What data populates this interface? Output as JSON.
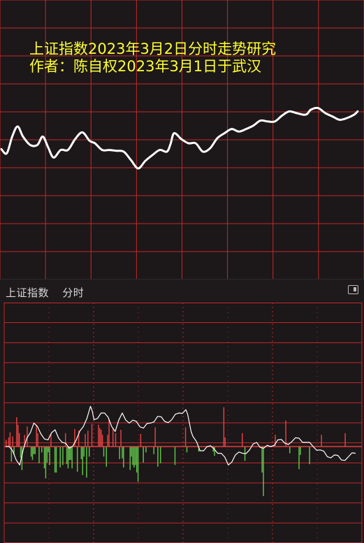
{
  "chart_data": [
    {
      "type": "line",
      "title_line1": "上证指数2023年3月2日分时走势研究",
      "title_line2": "作者：陈自权2023年3月1日于武汉",
      "title_color": "#ffff33",
      "grid": true,
      "grid_color": "#c02a2a",
      "line_color": "#ffffff",
      "xlim": [
        0,
        100
      ],
      "ylim": [
        0,
        100
      ],
      "series": [
        {
          "x": [
            0,
            1.5,
            3,
            4.5,
            6,
            8,
            10,
            11.5,
            13,
            14.5,
            16.5,
            18.5,
            20.5,
            22.5,
            24.5,
            26,
            28,
            30,
            32,
            34,
            36,
            38,
            40,
            42,
            44,
            46,
            47,
            48,
            50,
            52,
            54,
            56,
            58,
            60,
            62,
            64,
            66,
            68,
            70,
            72,
            74,
            76,
            78,
            80,
            82,
            84,
            85,
            86,
            88,
            90,
            92,
            94,
            96,
            98,
            99
          ],
          "y": [
            43,
            38,
            58,
            70,
            58,
            48,
            48,
            58,
            45,
            33,
            42,
            42,
            55,
            63,
            53,
            50,
            42,
            42,
            41,
            40,
            30,
            20,
            29,
            36,
            42,
            40,
            49,
            62,
            55,
            50,
            50,
            40,
            44,
            56,
            62,
            67,
            64,
            67,
            71,
            77,
            76,
            76,
            83,
            88,
            86,
            84,
            85,
            90,
            92,
            86,
            82,
            78,
            80,
            84,
            88
          ]
        }
      ]
    },
    {
      "type": "bar",
      "subtype": "intraday-volume-with-line",
      "grid": true,
      "grid_color": "#c02a2a",
      "up_color": "#e04040",
      "down_color": "#5fbf4a",
      "line_color": "#ffffff",
      "ylim": [
        -100,
        100
      ],
      "bars": [
        8,
        0,
        11,
        17,
        -18,
        12,
        -10,
        0,
        35,
        26,
        16,
        -13,
        -28,
        0,
        14,
        0,
        24,
        0,
        0,
        -12,
        -16,
        -9,
        -9,
        26,
        16,
        -20,
        0,
        -7,
        0,
        -26,
        -38,
        -19,
        -7,
        -22,
        15,
        0,
        0,
        -31,
        -31,
        0,
        0,
        -25,
        0,
        -22,
        0,
        16,
        -21,
        -26,
        -16,
        -16,
        -26,
        0,
        21,
        0,
        -30,
        19,
        0,
        -15,
        -34,
        -12,
        15,
        -37,
        19,
        -12,
        0,
        27,
        0,
        0,
        0,
        0,
        26,
        22,
        20,
        14,
        -12,
        0,
        -24,
        14,
        33,
        0,
        0,
        22,
        0,
        16,
        0,
        0,
        -15,
        20,
        -14,
        -25,
        0,
        0,
        0,
        0,
        -28,
        -12,
        -22,
        -25,
        -22,
        -31,
        -42,
        0,
        15,
        0,
        -19,
        0,
        -7,
        0,
        0,
        0,
        0,
        0,
        -9,
        23,
        0,
        -24,
        0,
        -20,
        0,
        0,
        0,
        0,
        0,
        0,
        0,
        0,
        0,
        0,
        -22,
        0,
        0,
        0,
        0,
        0,
        0,
        0,
        23,
        -7,
        0,
        0,
        0,
        0,
        0,
        0,
        0,
        0,
        -6,
        0,
        0,
        0,
        0,
        0,
        0,
        0,
        0,
        0,
        0,
        -6,
        -11,
        0,
        0,
        0,
        0,
        0,
        0,
        47,
        11,
        0,
        0,
        0,
        0,
        0,
        0,
        0,
        0,
        0,
        0,
        0,
        0,
        16,
        0,
        -17,
        0,
        0,
        0,
        0,
        0,
        0,
        0,
        0,
        0,
        0,
        0,
        0,
        -31,
        -59,
        0,
        0,
        0,
        0,
        0,
        0,
        0,
        0,
        14,
        0,
        0,
        0,
        0,
        0,
        0,
        0,
        31,
        0,
        0,
        -8,
        0,
        0,
        0,
        0,
        0,
        0,
        -27,
        -10,
        0,
        0,
        0,
        0,
        0,
        0,
        -21,
        0,
        0,
        0,
        0,
        0,
        0,
        0,
        0,
        14,
        0,
        0,
        0,
        0,
        0,
        0,
        0,
        0,
        0,
        0,
        0,
        0,
        0,
        0,
        0,
        0,
        0,
        16,
        0,
        0,
        0,
        0,
        0,
        0,
        0,
        0,
        0,
        0,
        0
      ],
      "line_x": [
        0,
        2,
        4,
        6,
        8,
        10,
        12,
        14,
        16,
        18,
        20,
        22,
        24,
        25,
        27,
        29,
        31,
        33,
        35,
        37,
        39,
        41,
        43,
        45,
        47,
        49,
        51,
        52,
        53,
        55,
        57,
        59,
        61,
        63,
        65,
        67,
        69,
        71,
        73,
        75,
        77,
        79,
        81,
        83,
        85,
        87,
        89,
        91,
        93,
        95,
        97,
        99
      ],
      "line_y": [
        0,
        -5,
        -22,
        10,
        28,
        15,
        8,
        20,
        5,
        -2,
        8,
        24,
        48,
        32,
        40,
        35,
        18,
        40,
        28,
        30,
        22,
        28,
        36,
        30,
        32,
        40,
        44,
        28,
        12,
        -5,
        0,
        -3,
        -8,
        -22,
        -10,
        -8,
        -4,
        5,
        -2,
        0,
        8,
        4,
        6,
        10,
        5,
        0,
        -4,
        -12,
        -10,
        -16,
        -12,
        -8
      ]
    }
  ],
  "panel": {
    "title": "上证指数",
    "period": "分时"
  }
}
